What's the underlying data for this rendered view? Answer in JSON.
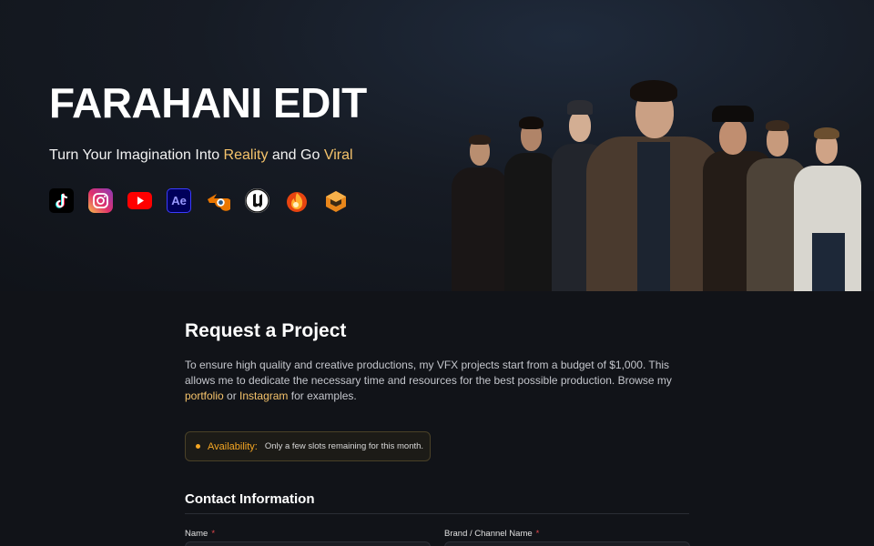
{
  "hero": {
    "title": "FARAHANI EDIT",
    "tagline_part1": "Turn Your Imagination Into ",
    "tagline_accent1": "Reality",
    "tagline_part2": " and Go ",
    "tagline_accent2": "Viral",
    "accent_color": "#f5c36b",
    "tool_icons": [
      "tiktok-icon",
      "instagram-icon",
      "youtube-icon",
      "after-effects-icon",
      "blender-icon",
      "unreal-engine-icon",
      "fire-icon",
      "box-icon"
    ],
    "ae_icon_text": "Ae"
  },
  "request": {
    "title": "Request a Project",
    "intro_part1": "To ensure high quality and creative productions, my VFX projects start from a budget of $1,000. This allows me to dedicate the necessary time and resources for the best possible production. Browse my ",
    "portfolio_link": "portfolio",
    "intro_or": " or ",
    "instagram_link": "Instagram",
    "intro_part2": " for examples."
  },
  "availability": {
    "label": "Availability:",
    "text": "Only a few slots remaining for this month.",
    "color": "#f5a623"
  },
  "contact": {
    "title": "Contact Information",
    "fields": [
      {
        "label": "Name",
        "required_mark": "*"
      },
      {
        "label": "Brand / Channel Name",
        "required_mark": "*"
      }
    ]
  }
}
